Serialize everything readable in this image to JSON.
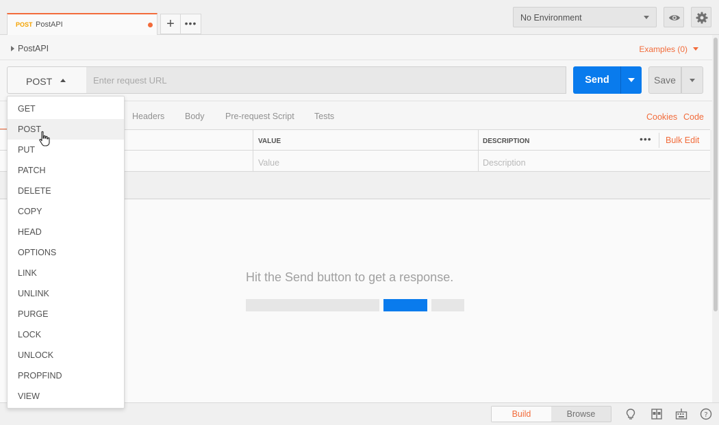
{
  "tabbar": {
    "tab": {
      "method": "POST",
      "name": "PostAPI"
    },
    "add_label": "+",
    "more_label": "•••"
  },
  "environment": {
    "selected": "No Environment"
  },
  "request": {
    "name": "PostAPI",
    "examples_label": "Examples (0)",
    "method": "POST",
    "url_placeholder": "Enter request URL",
    "send_label": "Send",
    "save_label": "Save"
  },
  "request_tabs": {
    "items": [
      "Headers",
      "Body",
      "Pre-request Script",
      "Tests"
    ],
    "cookies_label": "Cookies",
    "code_label": "Code"
  },
  "params_table": {
    "columns": [
      "VALUE",
      "DESCRIPTION"
    ],
    "value_placeholder": "Value",
    "description_placeholder": "Description",
    "more_label": "•••",
    "bulk_edit_label": "Bulk Edit"
  },
  "response": {
    "message": "Hit the Send button to get a response."
  },
  "statusbar": {
    "build_label": "Build",
    "browse_label": "Browse"
  },
  "method_dropdown": {
    "hovered": "POST",
    "items": [
      "GET",
      "POST",
      "PUT",
      "PATCH",
      "DELETE",
      "COPY",
      "HEAD",
      "OPTIONS",
      "LINK",
      "UNLINK",
      "PURGE",
      "LOCK",
      "UNLOCK",
      "PROPFIND",
      "VIEW"
    ]
  },
  "colors": {
    "accent_orange": "#f26b3a",
    "send_blue": "#097bed",
    "method_tab_yellow": "#f4a300"
  },
  "icons": {
    "environment_quicklook": "eye-icon",
    "settings": "gear-icon",
    "bootcamp": "lightbulb-icon",
    "two_pane": "two-pane-icon",
    "keyboard": "keyboard-icon",
    "help": "help-icon"
  }
}
